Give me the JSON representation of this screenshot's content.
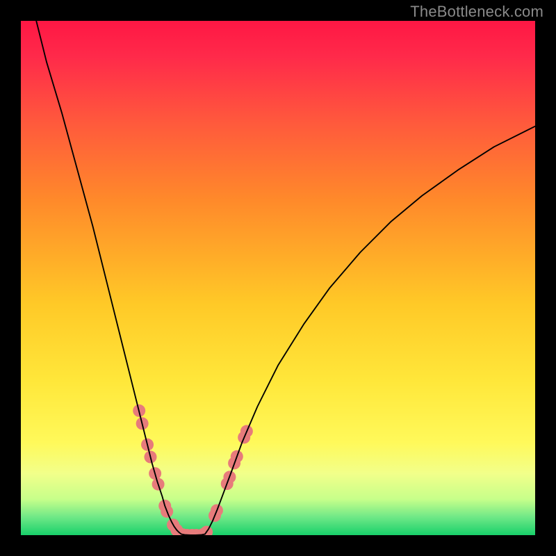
{
  "watermark": "TheBottleneck.com",
  "chart_data": {
    "type": "line",
    "title": "",
    "xlabel": "",
    "ylabel": "",
    "xlim": [
      0,
      100
    ],
    "ylim": [
      0,
      100
    ],
    "grid": false,
    "legend": false,
    "gradient_stops": [
      {
        "offset": 0.0,
        "color": "#ff1744"
      },
      {
        "offset": 0.07,
        "color": "#ff2a4a"
      },
      {
        "offset": 0.2,
        "color": "#ff5a3c"
      },
      {
        "offset": 0.35,
        "color": "#ff8a2a"
      },
      {
        "offset": 0.55,
        "color": "#ffc927"
      },
      {
        "offset": 0.7,
        "color": "#ffe73a"
      },
      {
        "offset": 0.82,
        "color": "#fff95a"
      },
      {
        "offset": 0.88,
        "color": "#f2ff8a"
      },
      {
        "offset": 0.93,
        "color": "#c7ff8a"
      },
      {
        "offset": 0.965,
        "color": "#6fe887"
      },
      {
        "offset": 1.0,
        "color": "#18d06a"
      }
    ],
    "series": [
      {
        "name": "bottleneck-curve-left",
        "x": [
          3,
          5,
          8,
          11,
          14,
          17,
          19,
          21,
          23,
          24.5,
          25.5,
          26.5,
          27.5,
          28,
          28.7,
          29.3,
          29.8,
          30.3,
          30.8,
          31.2
        ],
        "y": [
          100,
          92,
          82,
          71,
          60,
          48,
          40,
          32,
          24,
          18,
          14,
          10.5,
          7.5,
          5.7,
          3.9,
          2.6,
          1.7,
          1.0,
          0.5,
          0.2
        ]
      },
      {
        "name": "bottleneck-curve-floor",
        "x": [
          31.2,
          32.0,
          33.0,
          34.0,
          35.0,
          35.8
        ],
        "y": [
          0.2,
          0.05,
          0.0,
          0.0,
          0.05,
          0.2
        ]
      },
      {
        "name": "bottleneck-curve-right",
        "x": [
          35.8,
          36.5,
          37.3,
          38.2,
          39.4,
          41,
          43,
          46,
          50,
          55,
          60,
          66,
          72,
          78,
          85,
          92,
          100
        ],
        "y": [
          0.2,
          1.2,
          2.8,
          5.0,
          8.2,
          12.5,
          18,
          25,
          33,
          41,
          48,
          55,
          61,
          66,
          71,
          75.5,
          79.5
        ]
      }
    ],
    "markers": {
      "name": "highlight-dots",
      "color": "#e77b7b",
      "radius_px": 9,
      "points": [
        {
          "x": 23.0,
          "y": 24.2
        },
        {
          "x": 23.6,
          "y": 21.7
        },
        {
          "x": 24.6,
          "y": 17.6
        },
        {
          "x": 25.2,
          "y": 15.2
        },
        {
          "x": 26.1,
          "y": 12.0
        },
        {
          "x": 26.7,
          "y": 9.9
        },
        {
          "x": 28.0,
          "y": 5.7
        },
        {
          "x": 28.4,
          "y": 4.6
        },
        {
          "x": 29.6,
          "y": 2.0
        },
        {
          "x": 30.3,
          "y": 1.0
        },
        {
          "x": 31.5,
          "y": 0.1
        },
        {
          "x": 32.3,
          "y": 0.0
        },
        {
          "x": 33.3,
          "y": 0.0
        },
        {
          "x": 34.1,
          "y": 0.0
        },
        {
          "x": 35.3,
          "y": 0.1
        },
        {
          "x": 36.1,
          "y": 0.6
        },
        {
          "x": 37.7,
          "y": 3.8
        },
        {
          "x": 38.1,
          "y": 4.8
        },
        {
          "x": 40.1,
          "y": 10.0
        },
        {
          "x": 40.6,
          "y": 11.3
        },
        {
          "x": 41.5,
          "y": 14.0
        },
        {
          "x": 42.0,
          "y": 15.3
        },
        {
          "x": 43.4,
          "y": 19.0
        },
        {
          "x": 43.9,
          "y": 20.2
        }
      ]
    }
  }
}
